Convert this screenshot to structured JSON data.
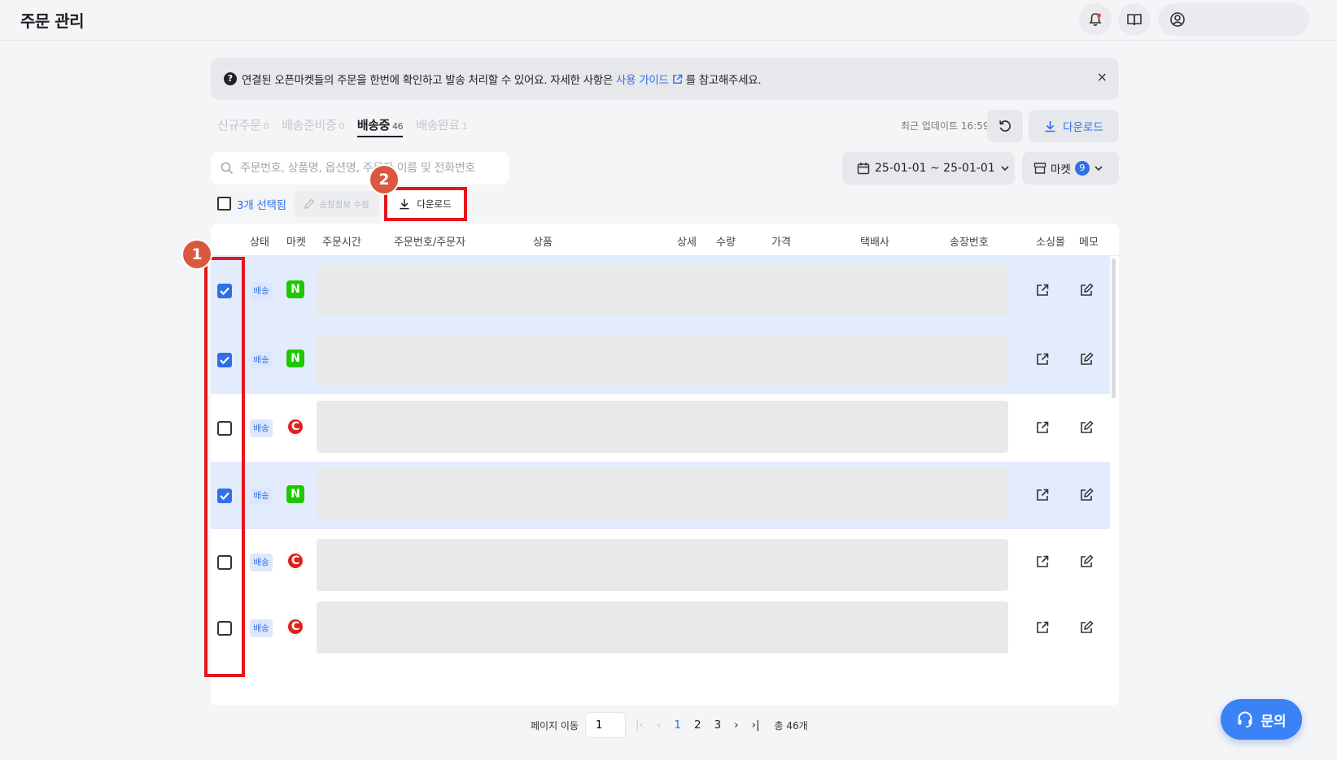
{
  "header": {
    "title": "주문 관리"
  },
  "notice": {
    "text_before": "연결된 오픈마켓들의 주문을 한번에 확인하고 발송 처리할 수 있어요. 자세한 사항은",
    "link_text": "사용 가이드",
    "text_after": "를 참고해주세요.",
    "close": "×"
  },
  "tabs": [
    {
      "label": "신규주문",
      "count": "0"
    },
    {
      "label": "배송준비중",
      "count": "0"
    },
    {
      "label": "배송중",
      "count": "46"
    },
    {
      "label": "배송완료",
      "count": "1"
    }
  ],
  "toolbar": {
    "last_updated": "최근 업데이트 16:59",
    "download_label": "다운로드",
    "search_placeholder": "주문번호, 상품명, 옵션명, 주문자 이름 및 전화번호",
    "date_range": "25-01-01 ~ 25-01-01",
    "market_label": "마켓",
    "market_count": "9"
  },
  "actions": {
    "selected_text": "3개 선택됨",
    "edit_invoice": "송장정보 수정",
    "download": "다운로드"
  },
  "table": {
    "columns": [
      "상태",
      "마켓",
      "주문시간",
      "주문번호/주문자",
      "상품",
      "상세",
      "수량",
      "가격",
      "택배사",
      "송장번호",
      "소싱몰",
      "메모"
    ],
    "rows": [
      {
        "checked": true,
        "status": "배송",
        "market": "N",
        "market_type": "naver"
      },
      {
        "checked": true,
        "status": "배송",
        "market": "N",
        "market_type": "naver"
      },
      {
        "checked": false,
        "status": "배송",
        "market": "C",
        "market_type": "coupang"
      },
      {
        "checked": true,
        "status": "배송",
        "market": "N",
        "market_type": "naver"
      },
      {
        "checked": false,
        "status": "배송",
        "market": "C",
        "market_type": "coupang"
      },
      {
        "checked": false,
        "status": "배송",
        "market": "C",
        "market_type": "coupang"
      }
    ]
  },
  "annotations": {
    "one": "1",
    "two": "2"
  },
  "pagination": {
    "label": "페이지 이동",
    "input_value": "1",
    "pages": [
      "1",
      "2",
      "3"
    ],
    "current": "1",
    "total": "총 46개"
  },
  "help_button": {
    "label": "문의"
  },
  "colors": {
    "accent": "#2f6fe8",
    "naver": "#1ec800",
    "coupang": "#e02020",
    "annotation": "#e5161b"
  }
}
